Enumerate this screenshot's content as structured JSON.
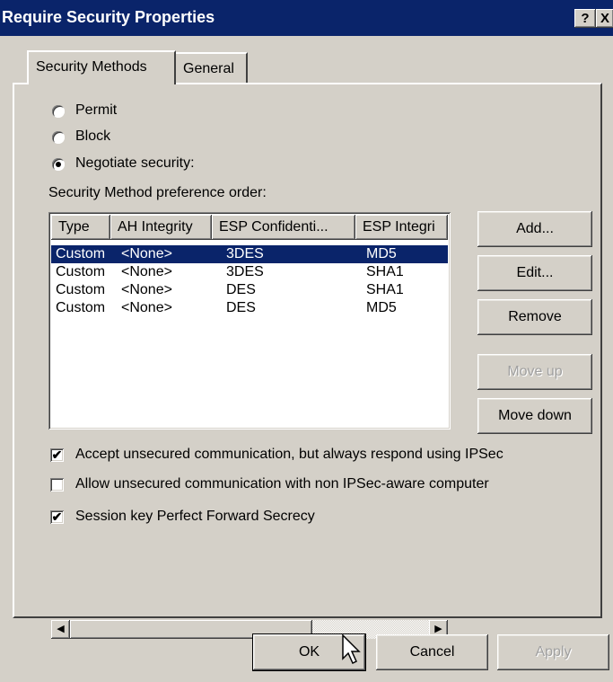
{
  "window": {
    "title": "Require Security Properties",
    "help_button": "?",
    "close_button": "X"
  },
  "tabs": [
    {
      "label": "Security Methods",
      "active": true
    },
    {
      "label": "General",
      "active": false
    }
  ],
  "radios": [
    {
      "label": "Permit",
      "checked": false
    },
    {
      "label": "Block",
      "checked": false
    },
    {
      "label": "Negotiate security:",
      "checked": true
    }
  ],
  "list": {
    "caption": "Security Method preference order:",
    "columns": [
      "Type",
      "AH Integrity",
      "ESP Confidenti...",
      "ESP Integri"
    ],
    "rows": [
      {
        "type": "Custom",
        "ah": "<None>",
        "esp_conf": "3DES",
        "esp_int": "MD5",
        "selected": true
      },
      {
        "type": "Custom",
        "ah": "<None>",
        "esp_conf": "3DES",
        "esp_int": "SHA1",
        "selected": false
      },
      {
        "type": "Custom",
        "ah": "<None>",
        "esp_conf": "DES",
        "esp_int": "SHA1",
        "selected": false
      },
      {
        "type": "Custom",
        "ah": "<None>",
        "esp_conf": "DES",
        "esp_int": "MD5",
        "selected": false
      }
    ]
  },
  "side_buttons": {
    "add": "Add...",
    "edit": "Edit...",
    "remove": "Remove",
    "move_up": "Move up",
    "move_down": "Move down"
  },
  "checkboxes": [
    {
      "label": "Accept unsecured communication, but always respond using IPSec",
      "checked": true
    },
    {
      "label": "Allow unsecured communication with non IPSec-aware computer",
      "checked": false
    },
    {
      "label": "Session key Perfect Forward Secrecy",
      "checked": true
    }
  ],
  "footer": {
    "ok": "OK",
    "cancel": "Cancel",
    "apply": "Apply"
  }
}
